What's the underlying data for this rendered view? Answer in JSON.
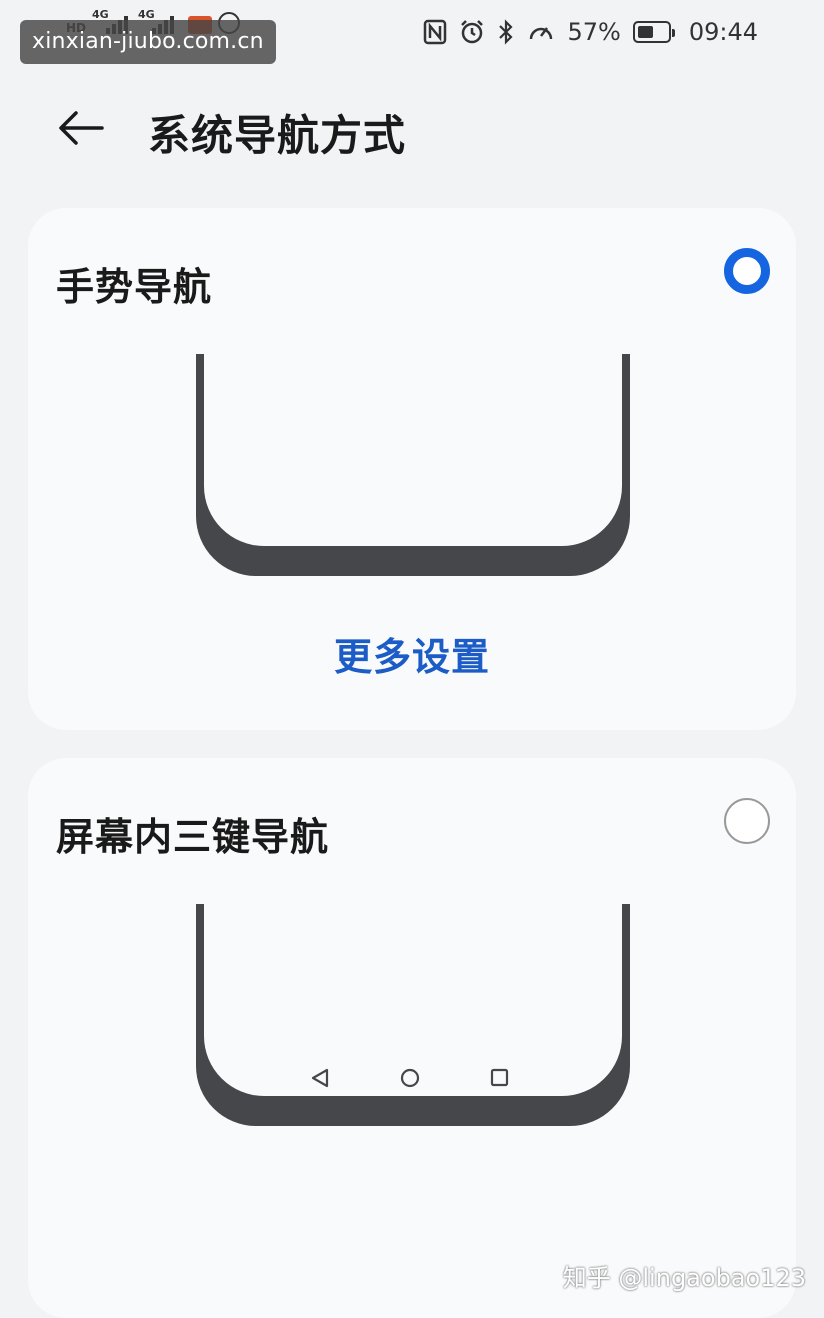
{
  "status_bar": {
    "hd_label": "HD",
    "network_1": "4G",
    "network_2": "4G",
    "battery_percent": "57%",
    "battery_level": 0.57,
    "time": "09:44",
    "icons": [
      "nfc-icon",
      "alarm-icon",
      "bluetooth-icon",
      "speed-icon",
      "battery-icon"
    ]
  },
  "watermark_top": "xinxian-jiubo.com.cn",
  "header": {
    "back_icon": "arrow-left-icon",
    "title": "系统导航方式"
  },
  "options": [
    {
      "title": "手势导航",
      "selected": true,
      "more_settings_label": "更多设置"
    },
    {
      "title": "屏幕内三键导航",
      "selected": false,
      "nav_keys": [
        "back-triangle-icon",
        "home-circle-icon",
        "recents-square-icon"
      ]
    }
  ],
  "watermark_bottom": "知乎 @lingaobao123",
  "colors": {
    "accent": "#1565e0",
    "link": "#1b5cc7",
    "card_bg": "#f9fafb",
    "page_bg": "#f1f3f5",
    "phone_frame": "#45474b"
  }
}
